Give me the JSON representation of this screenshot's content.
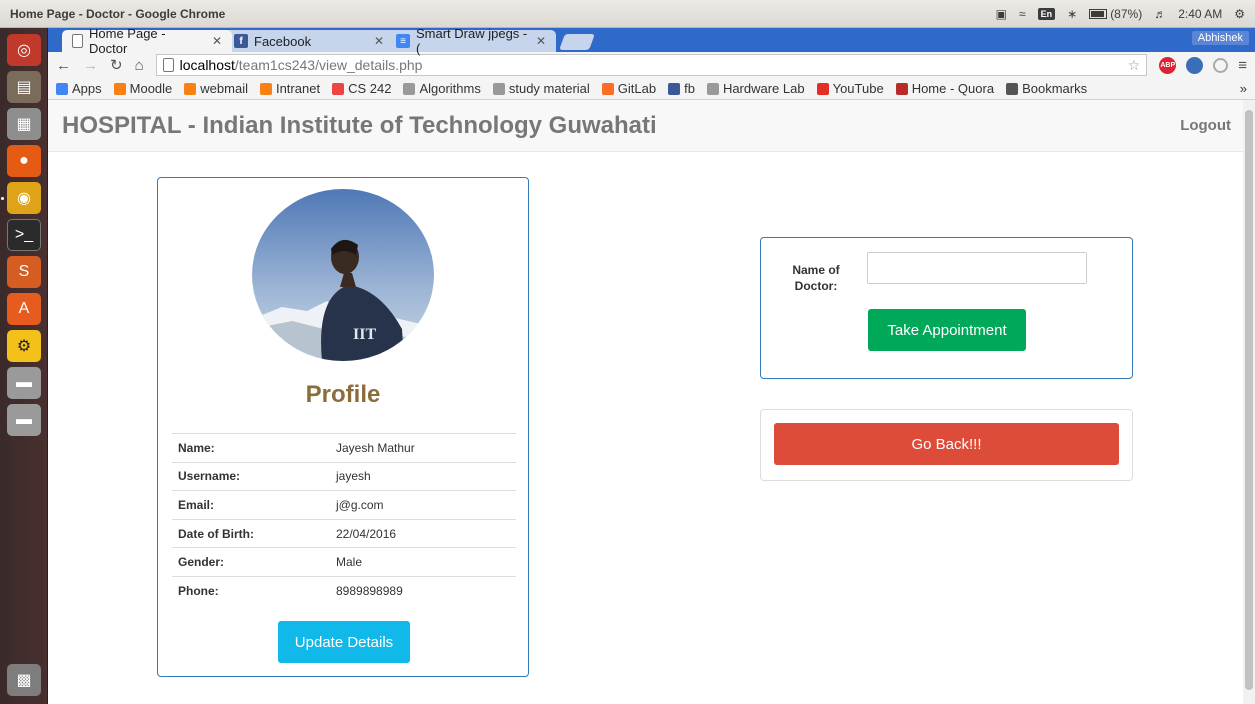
{
  "os": {
    "window_title": "Home Page - Doctor - Google Chrome",
    "keyboard": "En",
    "battery": "(87%)",
    "time": "2:40 AM"
  },
  "browser": {
    "tabs": [
      {
        "label": "Home Page - Doctor",
        "icon": "document-icon",
        "active": true
      },
      {
        "label": "Facebook",
        "icon": "facebook-icon",
        "active": false
      },
      {
        "label": "Smart Draw jpegs - (",
        "icon": "docs-icon",
        "active": false
      }
    ],
    "profile_name": "Abhishek",
    "url_host": "localhost",
    "url_path": "/team1cs243/view_details.php",
    "bookmarks": [
      {
        "label": "Apps",
        "icon": "apps-grid-icon",
        "color": "#4285f4"
      },
      {
        "label": "Moodle",
        "icon": "moodle-icon",
        "color": "#f98012"
      },
      {
        "label": "webmail",
        "icon": "moodle-icon",
        "color": "#f98012"
      },
      {
        "label": "Intranet",
        "icon": "moodle-icon",
        "color": "#f98012"
      },
      {
        "label": "CS 242",
        "icon": "ring-icon",
        "color": "#e44"
      },
      {
        "label": "Algorithms",
        "icon": "page-icon",
        "color": "#999"
      },
      {
        "label": "study material",
        "icon": "page-icon",
        "color": "#999"
      },
      {
        "label": "GitLab",
        "icon": "gitlab-icon",
        "color": "#fc6d26"
      },
      {
        "label": "fb",
        "icon": "facebook-icon",
        "color": "#3b5998"
      },
      {
        "label": "Hardware Lab",
        "icon": "page-icon",
        "color": "#999"
      },
      {
        "label": "YouTube",
        "icon": "youtube-icon",
        "color": "#e52d27"
      },
      {
        "label": "Home - Quora",
        "icon": "quora-icon",
        "color": "#b92b27"
      },
      {
        "label": "Bookmarks",
        "icon": "folder-icon",
        "color": "#555"
      }
    ],
    "more": "»"
  },
  "app": {
    "brand": "HOSPITAL - Indian Institute of Technology Guwahati",
    "logout": "Logout"
  },
  "profile": {
    "heading": "Profile",
    "rows": [
      {
        "label": "Name:",
        "value": "Jayesh Mathur"
      },
      {
        "label": "Username:",
        "value": "jayesh"
      },
      {
        "label": "Email:",
        "value": "j@g.com"
      },
      {
        "label": "Date of Birth:",
        "value": "22/04/2016"
      },
      {
        "label": "Gender:",
        "value": "Male"
      },
      {
        "label": "Phone:",
        "value": "8989898989"
      }
    ],
    "update_button": "Update Details",
    "shirt_text": "IIT"
  },
  "appointment": {
    "label_line1": "Name of",
    "label_line2": "Doctor:",
    "input_value": "",
    "button": "Take Appointment"
  },
  "back": {
    "button": "Go Back!!!"
  }
}
